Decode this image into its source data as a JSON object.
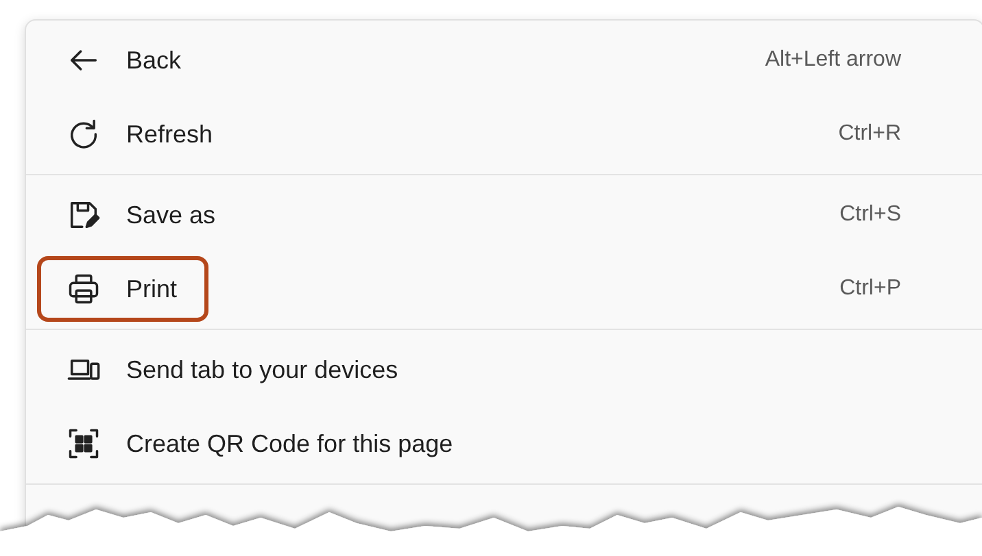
{
  "menu": {
    "sections": [
      {
        "items": [
          {
            "kind": "back",
            "label": "Back",
            "shortcut": "Alt+Left arrow",
            "highlighted": false
          },
          {
            "kind": "refresh",
            "label": "Refresh",
            "shortcut": "Ctrl+R",
            "highlighted": false
          }
        ]
      },
      {
        "items": [
          {
            "kind": "save",
            "label": "Save as",
            "shortcut": "Ctrl+S",
            "highlighted": false
          },
          {
            "kind": "print",
            "label": "Print",
            "shortcut": "Ctrl+P",
            "highlighted": true
          }
        ]
      },
      {
        "items": [
          {
            "kind": "devices",
            "label": "Send tab to your devices",
            "highlighted": false
          },
          {
            "kind": "qr",
            "label": "Create QR Code for this page",
            "highlighted": false
          }
        ]
      }
    ]
  }
}
